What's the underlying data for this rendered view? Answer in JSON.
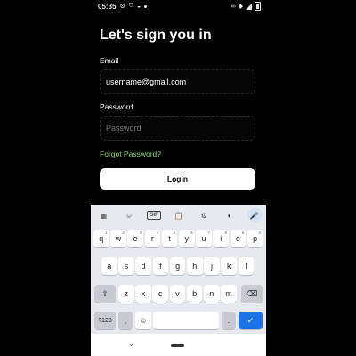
{
  "status_bar": {
    "time": "05:35",
    "icons": [
      "settings-icon",
      "shield-icon",
      "android-icon",
      "dot-icon",
      "link-icon",
      "wifi-icon",
      "signal-icon",
      "battery-icon"
    ]
  },
  "login_form": {
    "title": "Let's sign you in",
    "email_label": "Email",
    "email_value": "username@gmail.com",
    "password_label": "Password",
    "password_placeholder": "Password",
    "forgot_link": "Forgot Password?",
    "login_button": "Login"
  },
  "keyboard": {
    "toolbar": [
      "apps-icon",
      "sticker-icon",
      "GIF",
      "clipboard-icon",
      "gear-icon",
      "palette-icon",
      "mic-icon"
    ],
    "gif_label": "GIF",
    "row1": [
      {
        "k": "q",
        "n": "1"
      },
      {
        "k": "w",
        "n": "2"
      },
      {
        "k": "e",
        "n": "3"
      },
      {
        "k": "r",
        "n": "4"
      },
      {
        "k": "t",
        "n": "5"
      },
      {
        "k": "y",
        "n": "6"
      },
      {
        "k": "u",
        "n": "7"
      },
      {
        "k": "i",
        "n": "8"
      },
      {
        "k": "o",
        "n": "9"
      },
      {
        "k": "p",
        "n": "0"
      }
    ],
    "row2": [
      "a",
      "s",
      "d",
      "f",
      "g",
      "h",
      "j",
      "k",
      "l"
    ],
    "row3": [
      "z",
      "x",
      "c",
      "v",
      "b",
      "n",
      "m"
    ],
    "symbols_label": "?123",
    "comma": ",",
    "period": "."
  },
  "colors": {
    "background": "#000000",
    "link": "#8fd16a",
    "enter_key": "#1a73e8",
    "keyboard_bg": "#e6e9ee"
  }
}
